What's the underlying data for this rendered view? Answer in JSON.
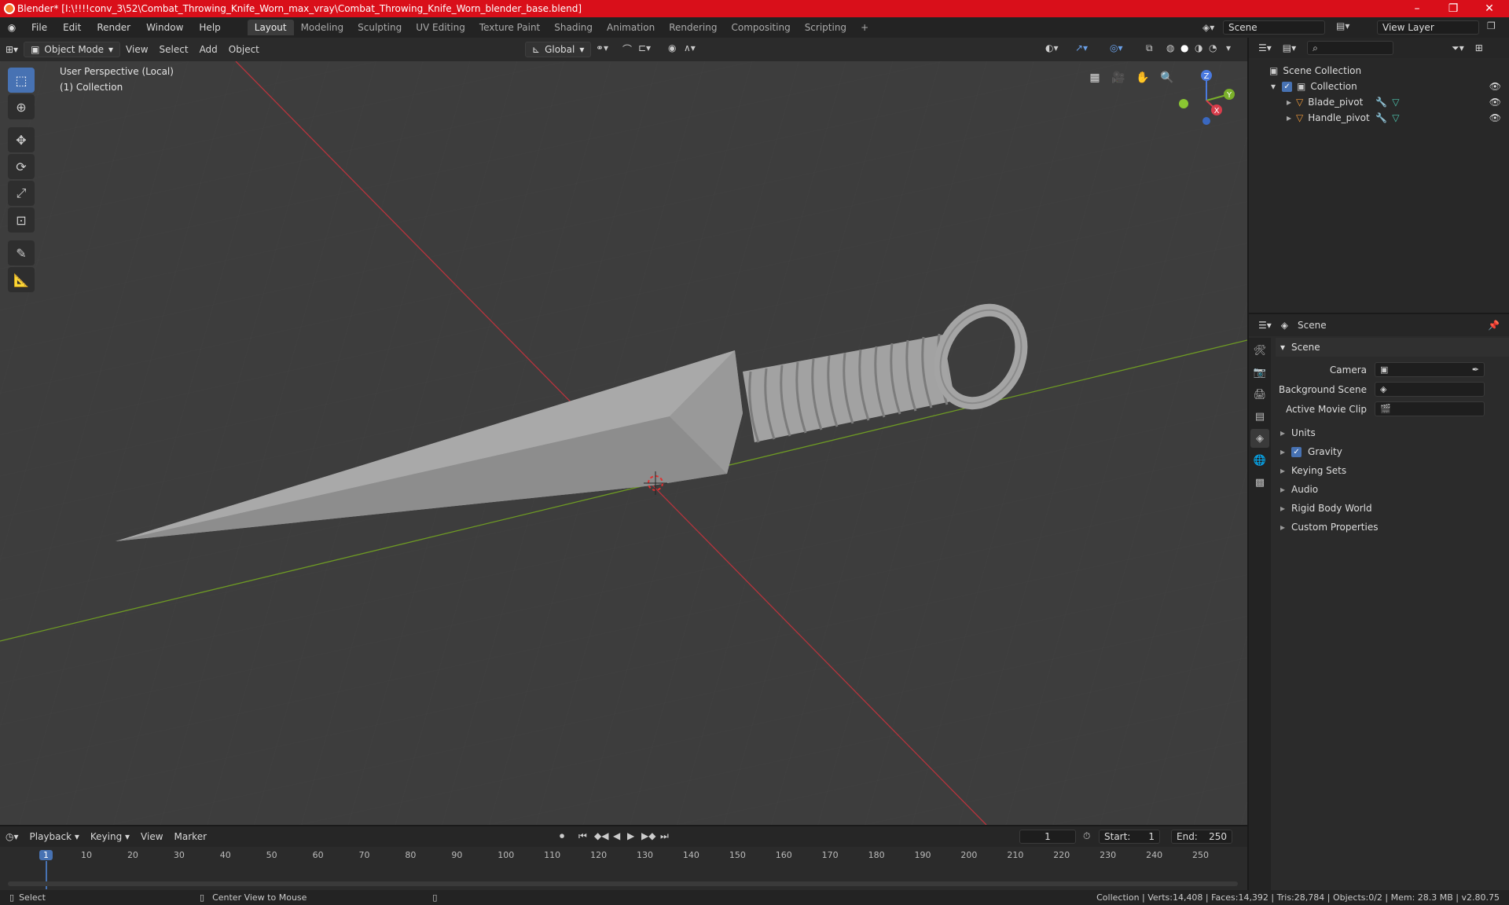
{
  "window": {
    "title": "Blender* [I:\\!!!!conv_3\\52\\Combat_Throwing_Knife_Worn_max_vray\\Combat_Throwing_Knife_Worn_blender_base.blend]"
  },
  "menus": [
    "File",
    "Edit",
    "Render",
    "Window",
    "Help"
  ],
  "workspaces": [
    "Layout",
    "Modeling",
    "Sculpting",
    "UV Editing",
    "Texture Paint",
    "Shading",
    "Animation",
    "Rendering",
    "Compositing",
    "Scripting"
  ],
  "active_workspace": "Layout",
  "scene_field": "Scene",
  "viewlayer_field": "View Layer",
  "viewport_header": {
    "mode": "Object Mode",
    "view": "View",
    "select": "Select",
    "add": "Add",
    "object": "Object",
    "orientation": "Global"
  },
  "viewport": {
    "perspective": "User Perspective (Local)",
    "collection": "(1) Collection"
  },
  "gizmo": {
    "x": "X",
    "y": "Y",
    "z": "Z"
  },
  "outliner": {
    "root": "Scene Collection",
    "collection": "Collection",
    "items": [
      "Blade_pivot",
      "Handle_pivot"
    ]
  },
  "properties": {
    "header": "Scene",
    "section": "Scene",
    "rows": [
      {
        "label": "Camera"
      },
      {
        "label": "Background Scene"
      },
      {
        "label": "Active Movie Clip"
      }
    ],
    "subsections": [
      "Units",
      "Gravity",
      "Keying Sets",
      "Audio",
      "Rigid Body World",
      "Custom Properties"
    ]
  },
  "timeline": {
    "menus": [
      "Playback",
      "Keying",
      "View",
      "Marker"
    ],
    "current_frame": "1",
    "start_label": "Start:",
    "start": "1",
    "end_label": "End:",
    "end": "250",
    "ruler": [
      "1",
      "10",
      "20",
      "30",
      "40",
      "50",
      "60",
      "70",
      "80",
      "90",
      "100",
      "110",
      "120",
      "130",
      "140",
      "150",
      "160",
      "170",
      "180",
      "190",
      "200",
      "210",
      "220",
      "230",
      "240",
      "250"
    ]
  },
  "statusbar": {
    "select": "Select",
    "center": "Center View to Mouse",
    "stats": "Collection | Verts:14,408 | Faces:14,392 | Tris:28,784 | Objects:0/2 | Mem: 28.3 MB | v2.80.75"
  },
  "colors": {
    "accent": "#4772b3",
    "titlebar": "#d90f1a",
    "x_axis": "#c8303a",
    "y_axis": "#7aa428"
  }
}
